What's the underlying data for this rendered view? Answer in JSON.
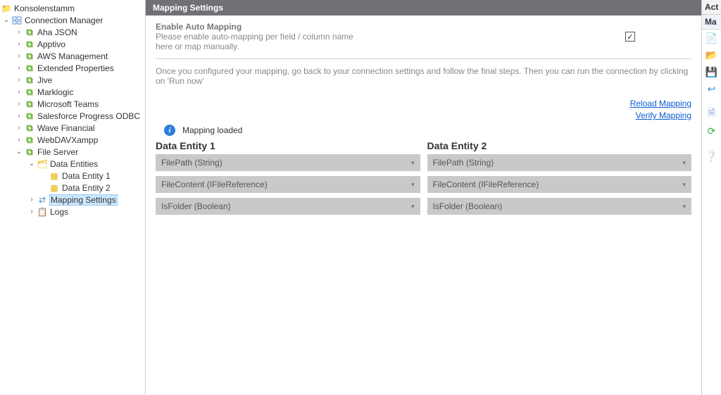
{
  "tree": {
    "root": "Konsolenstamm",
    "cm": "Connection Manager",
    "c0": "Aha JSON",
    "c1": "Apptivo",
    "c2": "AWS Management",
    "c3": "Extended Properties",
    "c4": "Jive",
    "c5": "Marklogic",
    "c6": "Microsoft Teams",
    "c7": "Salesforce Progress ODBC",
    "c8": "Wave Financial",
    "c9": "WebDAVXampp",
    "c10": "File Server",
    "de": "Data Entities",
    "de1": "Data Entity 1",
    "de2": "Data Entity 2",
    "map": "Mapping Settings",
    "logs": "Logs"
  },
  "main": {
    "header": "Mapping Settings",
    "enable_title": "Enable Auto Mapping",
    "enable_l1": "Please enable auto-mapping per field / column name",
    "enable_l2": "here or map manually.",
    "hint": "Once you configured your mapping, go back to your connection settings and follow the final steps. Then you can run the connection by clicking on 'Run now'",
    "link_reload": "Reload Mapping",
    "link_verify": "Verify Mapping",
    "status": "Mapping loaded",
    "entity1": {
      "title": "Data Entity 1",
      "f0": "FilePath (String)",
      "f1": "FileContent (IFileReference)",
      "f2": "IsFolder (Boolean)"
    },
    "entity2": {
      "title": "Data Entity 2",
      "f0": "FilePath (String)",
      "f1": "FileContent (IFileReference)",
      "f2": "IsFolder (Boolean)"
    }
  },
  "rightbar": {
    "hdr": "Act",
    "tab": "Ma"
  }
}
